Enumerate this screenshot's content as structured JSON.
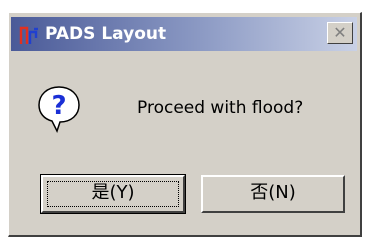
{
  "window": {
    "title": "PADS Layout",
    "close_label": "✕"
  },
  "icons": {
    "app": "pads-app-icon",
    "message": "question-icon",
    "close": "close-icon"
  },
  "message": {
    "text": "Proceed with flood?"
  },
  "buttons": {
    "yes_label": "是(Y)",
    "no_label": "否(N)"
  },
  "colors": {
    "dialog_face": "#d4d0c8",
    "titlebar_start": "#4a5a98",
    "titlebar_end": "#c9d1e6",
    "icon_blue": "#1a2fd6"
  }
}
